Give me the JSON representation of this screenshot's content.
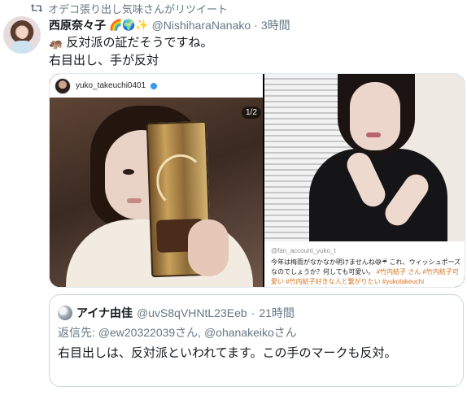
{
  "retweet": {
    "text": "オデコ張り出し気味さんがリツイート"
  },
  "tweet": {
    "author_name": "西原奈々子",
    "author_emojis": "🌈🌍✨",
    "handle": "@NishiharaNanako",
    "separator": "·",
    "time": "3時間",
    "text_line1_emoji": "🦛",
    "text_line1": "反対派の証だそうですね。",
    "text_line2": "右目出し、手が反対"
  },
  "media": {
    "left": {
      "ig_username": "yuko_takeuchi0401",
      "counter": "1/2"
    },
    "right": {
      "account": "@fan_account_yuko_t",
      "caption_plain": "今年は梅雨がなかなか明けませんね😅☔ これ、ウィッシュポーズなのでしょうか？何しても可愛い。",
      "caption_tags": "#竹内結子 さん #竹内結子可愛い #竹内結子好きな人と繋がりたい #yukotakeuchi"
    }
  },
  "quote": {
    "name": "アイナ由佳",
    "handle": "@uvS8qVHNtL23Eeb",
    "separator": "·",
    "time": "21時間",
    "reply_prefix": "返信先:",
    "reply_targets": "@ew20322039さん, @ohanakeikoさん",
    "text": "右目出しは、反対派といわれてます。この手のマークも反対。"
  },
  "colors": {
    "text": "#14171a",
    "secondary": "#657786",
    "border": "#ccd6dd"
  },
  "icons": [
    "retweet-icon",
    "verified-icon",
    "avatar"
  ]
}
